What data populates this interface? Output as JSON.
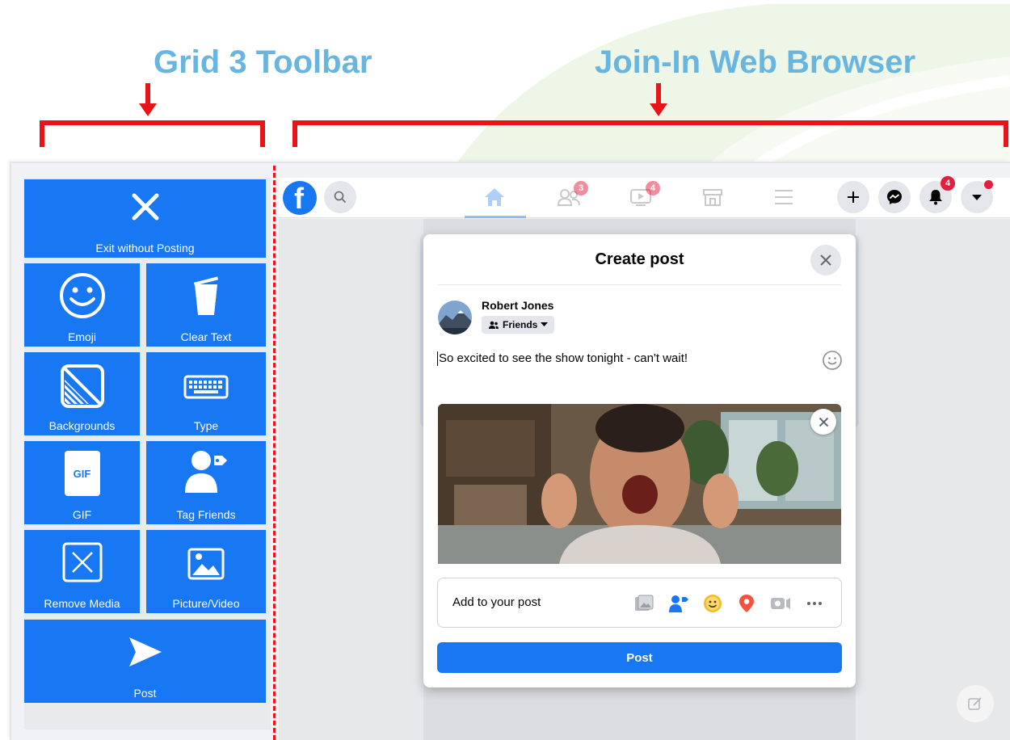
{
  "annotations": {
    "left_title": "Grid 3 Toolbar",
    "right_title": "Join-In Web Browser",
    "title_color": "#68b6e0",
    "bracket_color": "#e8141a"
  },
  "toolbar": {
    "accent": "#1877f2",
    "buttons": [
      {
        "label": "Exit without Posting",
        "icon": "close-icon"
      },
      {
        "label": "Emoji",
        "icon": "smiley-icon"
      },
      {
        "label": "Clear Text",
        "icon": "trash-icon"
      },
      {
        "label": "Backgrounds",
        "icon": "backgrounds-icon"
      },
      {
        "label": "Type",
        "icon": "keyboard-icon"
      },
      {
        "label": "GIF",
        "icon": "gif-icon"
      },
      {
        "label": "Tag Friends",
        "icon": "tag-person-icon"
      },
      {
        "label": "Remove Media",
        "icon": "remove-media-icon"
      },
      {
        "label": "Picture/Video",
        "icon": "picture-icon"
      },
      {
        "label": "Post",
        "icon": "send-icon"
      }
    ],
    "gif_icon_text": "GIF"
  },
  "browser": {
    "logo_letter": "f",
    "nav_badges": {
      "friends": "3",
      "watch": "4",
      "notifications": "4"
    },
    "create_post": {
      "title": "Create post",
      "user_name": "Robert Jones",
      "audience": "Friends",
      "text": "So excited to see the show tonight - can't wait!",
      "add_label": "Add to your post",
      "post_button": "Post",
      "add_icons": [
        "photo-video-icon",
        "tag-people-icon",
        "feeling-icon",
        "check-in-icon",
        "live-video-icon",
        "more-icon"
      ]
    }
  }
}
